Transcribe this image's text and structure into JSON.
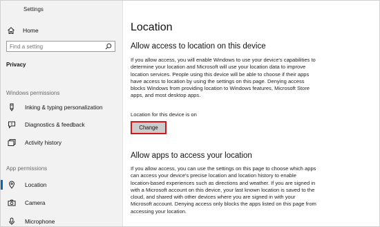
{
  "window": {
    "title": "Settings"
  },
  "sidebar": {
    "home_label": "Home",
    "search_placeholder": "Find a setting",
    "category": "Privacy",
    "windows_permissions_header": "Windows permissions",
    "app_permissions_header": "App permissions",
    "windows_items": [
      {
        "label": "Inking & typing personalization",
        "icon": "pen-icon"
      },
      {
        "label": "Diagnostics & feedback",
        "icon": "feedback-icon"
      },
      {
        "label": "Activity history",
        "icon": "history-icon"
      }
    ],
    "app_items": [
      {
        "label": "Location",
        "icon": "location-icon",
        "active": true
      },
      {
        "label": "Camera",
        "icon": "camera-icon"
      },
      {
        "label": "Microphone",
        "icon": "microphone-icon"
      }
    ],
    "accent_color": "#0067c0"
  },
  "main": {
    "title": "Location",
    "section1": {
      "heading": "Allow access to location on this device",
      "body": "If you allow access, you will enable Windows to use your device's capabilities to determine your location and Microsoft will use your location data to improve location services. People using this device will be able to choose if their apps have access to location by using the settings on this page. Denying access blocks Windows from providing location to Windows features, Microsoft Store apps, and most desktop apps.",
      "status": "Location for this device is on",
      "button_label": "Change",
      "button_highlight_color": "#d0171e"
    },
    "section2": {
      "heading": "Allow apps to access your location",
      "body": "If you allow access, you can use the settings on this page to choose which apps can access your device's precise location and location history to enable location-based experiences such as directions and weather. If you are signed in with a Microsoft account on this device, your last known location is saved to the cloud, and shared with other devices where you are signed in with your Microsoft account. Denying access only blocks the apps listed on this page from accessing your location."
    }
  }
}
